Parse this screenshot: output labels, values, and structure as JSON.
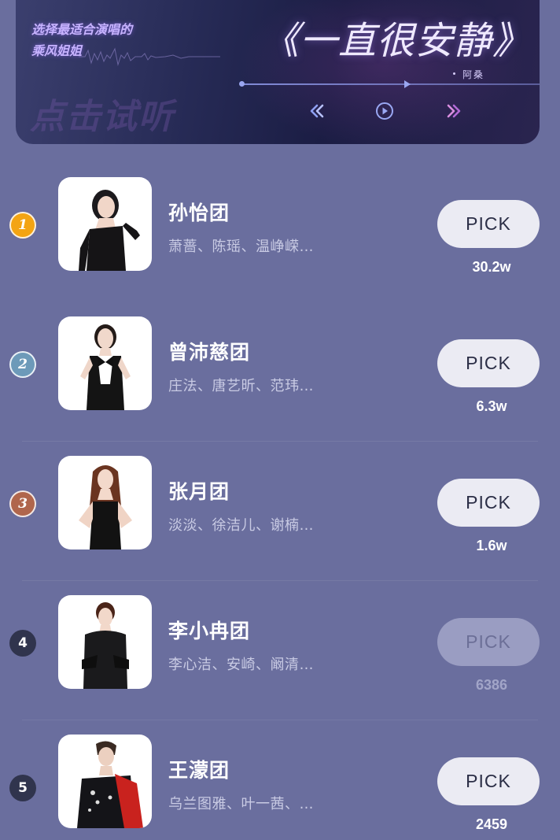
{
  "banner": {
    "tagline_line1": "选择最适合演唱的",
    "tagline_line2": "乘风姐姐",
    "ghost_text": "点击试听",
    "song_title": "《一直很安静》",
    "singer": "阿桑",
    "controls": {
      "prev_icon": "rewind-icon",
      "play_icon": "play-icon",
      "next_icon": "fast-forward-icon"
    },
    "colors": {
      "accent": "#c7b3ff",
      "progress": "#9aa6f0",
      "next_accent": "#c77bd8"
    }
  },
  "list": {
    "pick_label": "PICK",
    "items": [
      {
        "rank": "1",
        "team": "孙怡团",
        "members": "萧蔷、陈瑶、温峥嵘…",
        "votes": "30.2w",
        "rank_color": "#f3a413",
        "active": true
      },
      {
        "rank": "2",
        "team": "曾沛慈团",
        "members": "庄法、唐艺昕、范玮…",
        "votes": "6.3w",
        "rank_color": "#6d9ab9",
        "active": true
      },
      {
        "rank": "3",
        "team": "张月团",
        "members": "淡淡、徐洁儿、谢楠…",
        "votes": "1.6w",
        "rank_color": "#b0664c",
        "active": true
      },
      {
        "rank": "4",
        "team": "李小冉团",
        "members": "李心洁、安崎、阚清…",
        "votes": "6386",
        "rank_color": "#30344d",
        "active": false
      },
      {
        "rank": "5",
        "team": "王濛团",
        "members": "乌兰图雅、叶一茜、…",
        "votes": "2459",
        "rank_color": "#30344d",
        "active": true
      }
    ]
  }
}
